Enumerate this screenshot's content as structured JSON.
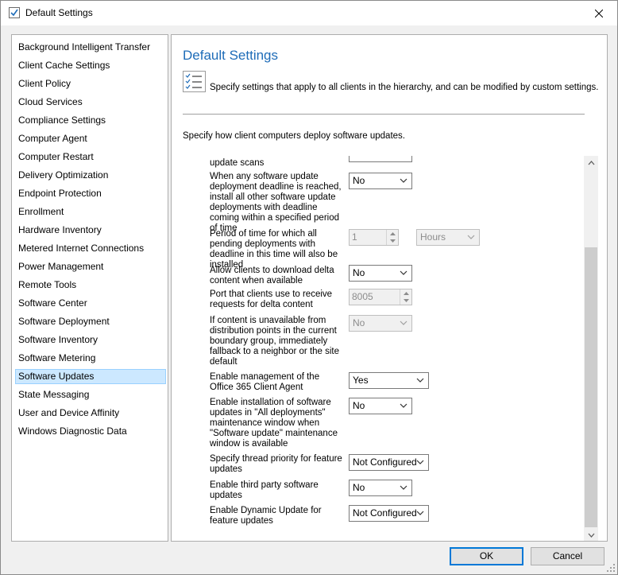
{
  "window": {
    "title": "Default Settings",
    "icon": "settings-document-icon"
  },
  "nav": {
    "items": [
      "Background Intelligent Transfer",
      "Client Cache Settings",
      "Client Policy",
      "Cloud Services",
      "Compliance Settings",
      "Computer Agent",
      "Computer Restart",
      "Delivery Optimization",
      "Endpoint Protection",
      "Enrollment",
      "Hardware Inventory",
      "Metered Internet Connections",
      "Power Management",
      "Remote Tools",
      "Software Center",
      "Software Deployment",
      "Software Inventory",
      "Software Metering",
      "Software Updates",
      "State Messaging",
      "User and Device Affinity",
      "Windows Diagnostic Data"
    ],
    "selected": "Software Updates"
  },
  "header": {
    "title": "Default Settings",
    "description": "Specify settings that apply to all clients in the hierarchy, and can be modified by custom settings.",
    "section": "Specify how client computers deploy software updates."
  },
  "settings": {
    "update_scans_label": "update scans",
    "deadline_reached_label": "When any software update deployment deadline is reached, install all other software update deployments with deadline coming within a specified period of time",
    "deadline_reached_value": "No",
    "period_label": "Period of time for which all pending deployments with deadline in this time will also be installed",
    "period_value": "1",
    "period_unit": "Hours",
    "delta_download_label": "Allow clients to download delta content when available",
    "delta_download_value": "No",
    "delta_port_label": "Port that clients use to receive requests for delta content",
    "delta_port_value": "8005",
    "fallback_label": "If content is unavailable from distribution points in the current boundary group, immediately fallback to a neighbor or the site default",
    "fallback_value": "No",
    "office365_label": "Enable management of the Office 365 Client Agent",
    "office365_value": "Yes",
    "all_deployments_label": "Enable installation of software updates in \"All deployments\" maintenance window when \"Software update\" maintenance window is available",
    "all_deployments_value": "No",
    "thread_priority_label": "Specify thread priority for feature updates",
    "thread_priority_value": "Not Configured",
    "third_party_label": "Enable third party software updates",
    "third_party_value": "No",
    "dynamic_update_label": "Enable Dynamic Update for feature updates",
    "dynamic_update_value": "Not Configured"
  },
  "footer": {
    "ok_label": "OK",
    "cancel_label": "Cancel"
  },
  "colors": {
    "accent": "#1e6cb8",
    "selection": "#cce8ff",
    "default_button_border": "#0078d7"
  }
}
